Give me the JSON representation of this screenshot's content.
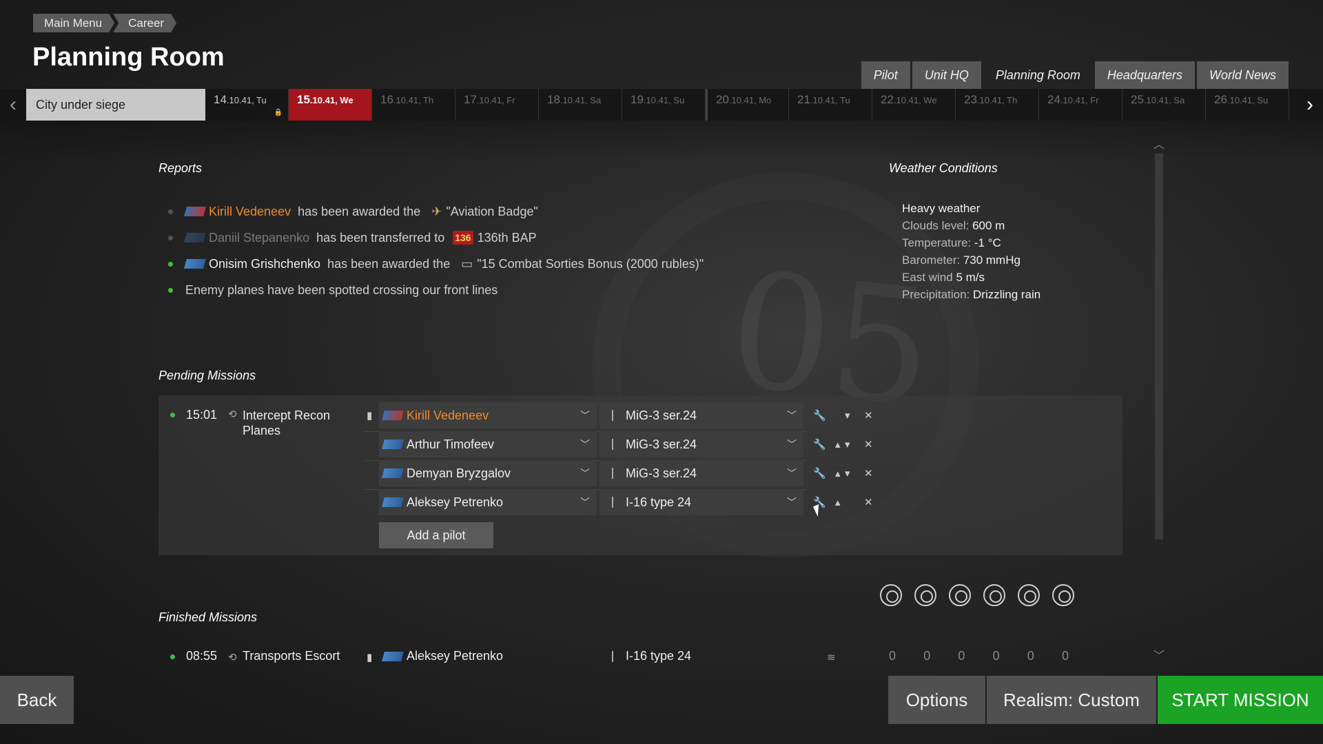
{
  "breadcrumb": [
    "Main Menu",
    "Career"
  ],
  "page_title": "Planning Room",
  "top_tabs": [
    {
      "label": "Pilot",
      "active": false
    },
    {
      "label": "Unit HQ",
      "active": false
    },
    {
      "label": "Planning Room",
      "active": true
    },
    {
      "label": "Headquarters",
      "active": false
    },
    {
      "label": "World News",
      "active": false
    }
  ],
  "datebar": {
    "campaign": "City under siege",
    "dates": [
      {
        "day": "14",
        "rest": ".10.41, Tu",
        "state": "past"
      },
      {
        "day": "15",
        "rest": ".10.41, We",
        "state": "current"
      },
      {
        "day": "16",
        "rest": ".10.41, Th",
        "state": "future"
      },
      {
        "day": "17",
        "rest": ".10.41, Fr",
        "state": "future"
      },
      {
        "day": "18",
        "rest": ".10.41, Sa",
        "state": "future"
      },
      {
        "day": "19",
        "rest": ".10.41, Su",
        "state": "future"
      },
      {
        "day": "20",
        "rest": ".10.41, Mo",
        "state": "future"
      },
      {
        "day": "21",
        "rest": ".10.41, Tu",
        "state": "future"
      },
      {
        "day": "22",
        "rest": ".10.41, We",
        "state": "future"
      },
      {
        "day": "23",
        "rest": ".10.41, Th",
        "state": "future"
      },
      {
        "day": "24",
        "rest": ".10.41, Fr",
        "state": "future"
      },
      {
        "day": "25",
        "rest": ".10.41, Sa",
        "state": "future"
      },
      {
        "day": "26",
        "rest": ".10.41, Su",
        "state": "future"
      }
    ]
  },
  "reports": {
    "title": "Reports",
    "items": [
      {
        "name": "Kirill Vedeneev",
        "action": "has been awarded the",
        "object": "\"Aviation Badge\""
      },
      {
        "name": "Daniil Stepanenko",
        "action": "has been transferred to",
        "badge": "136",
        "object": "136th BAP"
      },
      {
        "name": "Onisim Grishchenko",
        "action": "has been awarded the",
        "object": "\"15 Combat Sorties Bonus (2000 rubles)\""
      },
      {
        "text": "Enemy planes have been spotted crossing our front lines"
      }
    ]
  },
  "weather": {
    "title": "Weather Conditions",
    "line1": "Heavy weather",
    "clouds_label": "Clouds level: ",
    "clouds_value": "600 m",
    "temp_label": "Temperature: ",
    "temp_value": "-1 °C",
    "baro_label": "Barometer: ",
    "baro_value": "730 mmHg",
    "wind_label": "East wind ",
    "wind_value": "5 m/s",
    "precip_label": "Precipitation: ",
    "precip_value": "Drizzling rain"
  },
  "pending": {
    "title": "Pending Missions",
    "time": "15:01",
    "name": "Intercept Recon Planes",
    "slots": [
      {
        "pilot": "Kirill Vedeneev",
        "plane": "MiG-3 ser.24"
      },
      {
        "pilot": "Arthur Timofeev",
        "plane": "MiG-3 ser.24"
      },
      {
        "pilot": "Demyan Bryzgalov",
        "plane": "MiG-3 ser.24"
      },
      {
        "pilot": "Aleksey Petrenko",
        "plane": "I-16 type 24"
      }
    ],
    "add_pilot": "Add a pilot"
  },
  "finished": {
    "title": "Finished Missions",
    "time": "08:55",
    "name": "Transports Escort",
    "pilot": "Aleksey Petrenko",
    "plane": "I-16 type 24",
    "stats": [
      "0",
      "0",
      "0",
      "0",
      "0",
      "0"
    ]
  },
  "buttons": {
    "back": "Back",
    "options": "Options",
    "realism": "Realism: Custom",
    "start": "START MISSION"
  },
  "colors": {
    "accent_red": "#a5151d",
    "start_green": "#1aa324",
    "pilot_highlight": "#f08a2a"
  }
}
